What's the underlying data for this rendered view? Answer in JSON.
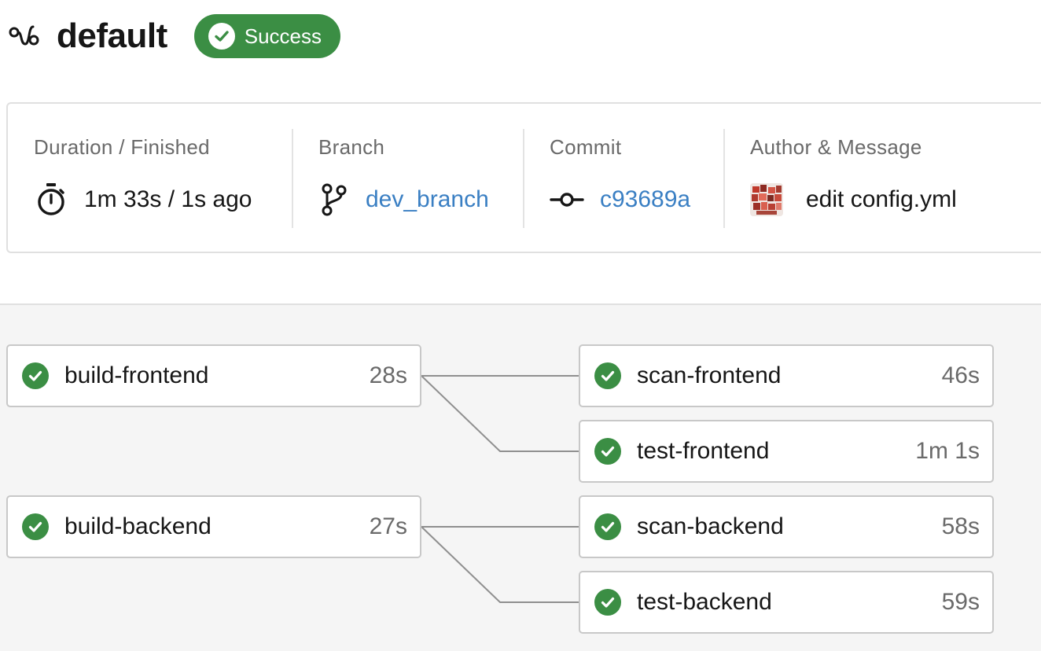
{
  "workflow": {
    "icon": "workflow-icon",
    "name": "default",
    "status": "Success",
    "status_color": "#3b8e44"
  },
  "info": {
    "duration": {
      "label": "Duration / Finished",
      "icon": "stopwatch-icon",
      "value": "1m 33s / 1s ago"
    },
    "branch": {
      "label": "Branch",
      "icon": "branch-icon",
      "value": "dev_branch"
    },
    "commit": {
      "label": "Commit",
      "icon": "commit-icon",
      "value": "c93689a"
    },
    "author": {
      "label": "Author & Message",
      "icon": "avatar",
      "value": "edit config.yml"
    }
  },
  "jobs": [
    {
      "name": "build-frontend",
      "time": "28s",
      "status": "success"
    },
    {
      "name": "scan-frontend",
      "time": "46s",
      "status": "success"
    },
    {
      "name": "test-frontend",
      "time": "1m 1s",
      "status": "success"
    },
    {
      "name": "build-backend",
      "time": "27s",
      "status": "success"
    },
    {
      "name": "scan-backend",
      "time": "58s",
      "status": "success"
    },
    {
      "name": "test-backend",
      "time": "59s",
      "status": "success"
    }
  ],
  "colors": {
    "success": "#3b8e44",
    "link": "#3a7fc3",
    "muted_text": "#6a6a6a"
  }
}
